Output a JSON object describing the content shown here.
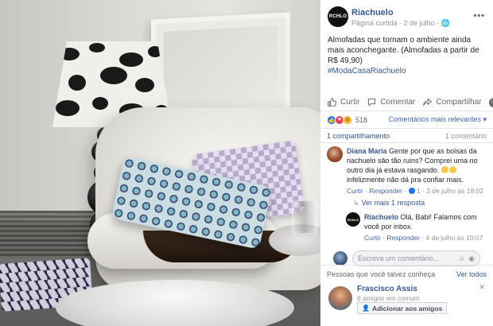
{
  "page": {
    "avatar_text": "RCHLO",
    "name": "Riachuelo",
    "meta": "Página curtida · 2 de julho · 🌐",
    "more_icon": "more-options-icon"
  },
  "post": {
    "text": "Almofadas que tornam o ambiente ainda mais aconchegante. (Almofadas a partir de R$ 49,90)",
    "hashtag": "#ModaCasaRiachuelo"
  },
  "actions": {
    "like": "Curtir",
    "comment": "Comentar",
    "share": "Compartilhar"
  },
  "reactions": {
    "count": "518",
    "sort": "Comentários mais relevantes ▾"
  },
  "engagement": {
    "shares": "1 compartilhamento",
    "comments": "1 comentário"
  },
  "comment": {
    "author": "Diana Maria",
    "text_a": "Gente por que as bolsas da riachuelo são tão ruins? Comprei uma no outro dia já estava rasgando.",
    "text_b": "infelizmente não dá pra confiar mais.",
    "like": "Curtir",
    "reply": "Responder",
    "likes": "1",
    "time": "2 de julho às 18:02",
    "more_replies": "Ver mais 1 resposta"
  },
  "reply": {
    "author": "Riachuelo",
    "avatar_text": "RCHLO",
    "text": "Olá, Babi! Falamos com você por inbox.",
    "like": "Curtir",
    "reply": "Responder",
    "time": "4 de julho às 10:07"
  },
  "composer": {
    "placeholder": "Escreva um comentário..."
  },
  "suggestions": {
    "title": "Pessoas que você talvez conheça",
    "see_all": "Ver todos",
    "person": {
      "name": "Frascisco Assis",
      "mutual": "6 amigos em comum",
      "add": "Adicionar aos amigos"
    }
  }
}
